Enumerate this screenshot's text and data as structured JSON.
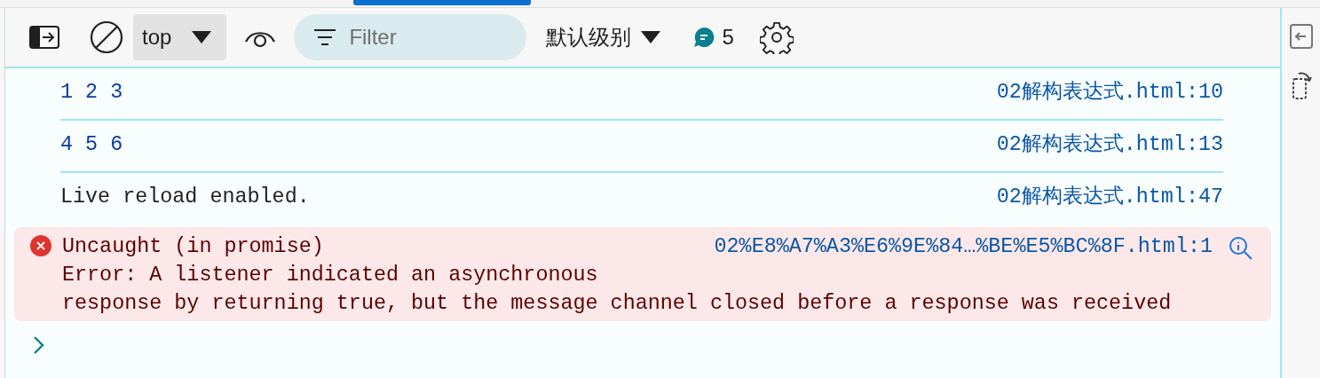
{
  "toolbar": {
    "context": "top",
    "filter": {
      "placeholder": "Filter"
    },
    "level": "默认级别",
    "message_count": "5"
  },
  "messages": [
    {
      "kind": "log",
      "text": "1 2 3",
      "source": "02解构表达式.html:10"
    },
    {
      "kind": "log",
      "text": "4 5 6",
      "source": "02解构表达式.html:13"
    },
    {
      "kind": "log",
      "text": "Live reload enabled.",
      "source": "02解构表达式.html:47"
    },
    {
      "kind": "error",
      "text": "Uncaught (in promise)",
      "detail": [
        "Error: A listener indicated an asynchronous",
        "response by returning true, but the message channel closed before a response was received"
      ],
      "source": "02%E8%A7%A3%E6%9E%84…%BE%E5%BC%8F.html:1"
    }
  ]
}
